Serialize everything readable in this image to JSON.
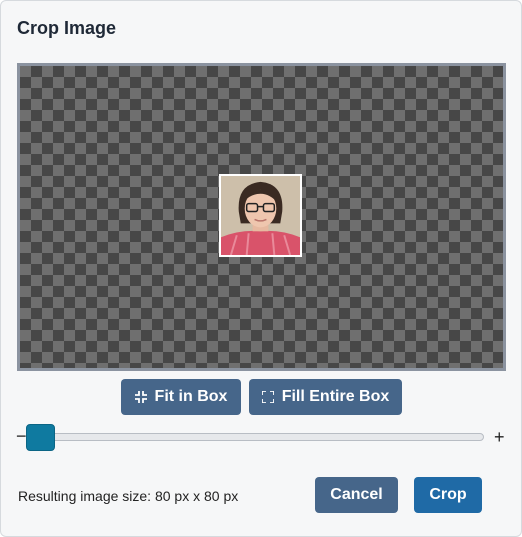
{
  "dialog": {
    "title": "Crop Image"
  },
  "crop_area": {
    "zoom_level": 0.05
  },
  "controls": {
    "fit_label": "Fit in Box",
    "fit_icon": "compress-icon",
    "fill_label": "Fill Entire Box",
    "fill_icon": "expand-icon",
    "zoom_minus": "−",
    "zoom_plus": "+"
  },
  "footer": {
    "result_text": "Resulting image size: 80 px x 80 px",
    "cancel_label": "Cancel",
    "crop_label": "Crop"
  },
  "colors": {
    "button_secondary": "#46668a",
    "button_primary": "#1f6aa6",
    "slider_thumb": "#0f7aa0"
  }
}
